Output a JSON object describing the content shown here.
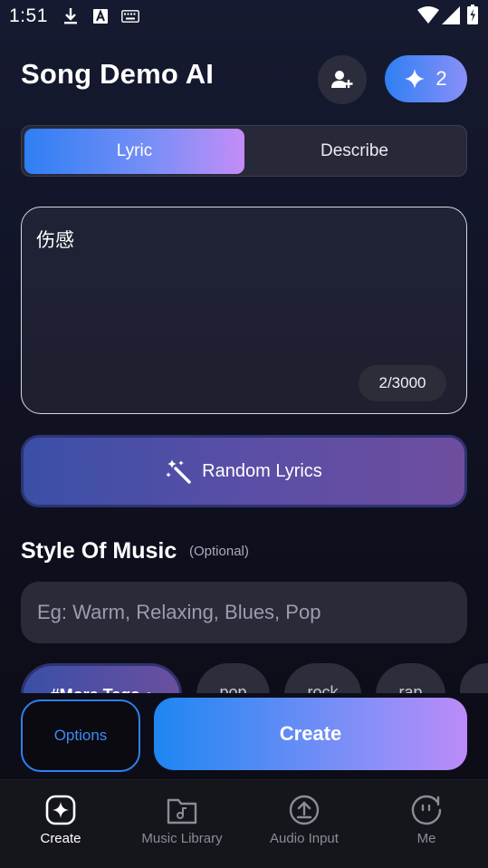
{
  "status_bar": {
    "time": "1:51",
    "icons": [
      "download-icon",
      "font-a-icon",
      "keyboard-icon",
      "wifi-icon",
      "signal-icon",
      "battery-icon"
    ]
  },
  "header": {
    "title": "Song Demo AI",
    "add_user_icon": "add-user-icon",
    "credits_count": "2",
    "credits_icon": "sparkle-icon"
  },
  "tabs": [
    {
      "label": "Lyric",
      "active": true
    },
    {
      "label": "Describe",
      "active": false
    }
  ],
  "lyrics": {
    "value": "伤感",
    "char_count": "2/3000"
  },
  "random_lyrics": {
    "label": "Random Lyrics",
    "icon": "magic-wand-icon"
  },
  "style": {
    "title": "Style Of Music",
    "optional": "(Optional)",
    "placeholder": "Eg: Warm, Relaxing, Blues, Pop"
  },
  "tags": {
    "more": "#More Tags",
    "items": [
      "pop",
      "rock",
      "rap"
    ]
  },
  "actions": {
    "options": "Options",
    "create": "Create"
  },
  "bottom_nav": [
    {
      "label": "Create",
      "icon": "create-icon",
      "active": true
    },
    {
      "label": "Music Library",
      "icon": "music-folder-icon",
      "active": false
    },
    {
      "label": "Audio Input",
      "icon": "upload-icon",
      "active": false
    },
    {
      "label": "Me",
      "icon": "face-icon",
      "active": false
    }
  ],
  "colors": {
    "accent_blue": "#2f7ff3",
    "accent_purple": "#c48cf7",
    "background": "#111427"
  }
}
